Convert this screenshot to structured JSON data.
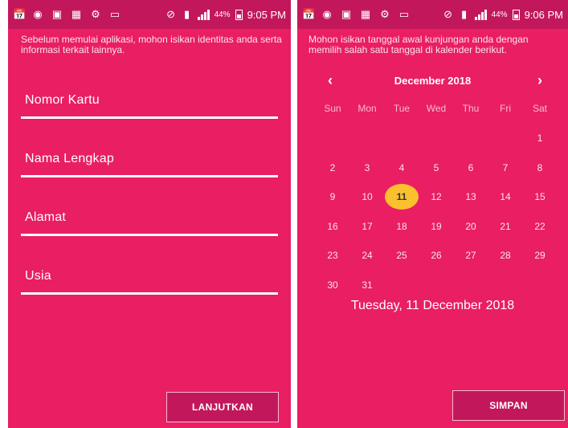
{
  "left_screen": {
    "status": {
      "time": "9:05 PM",
      "battery": "44%"
    },
    "intro": "Sebelum memulai aplikasi, mohon isikan identitas anda serta informasi terkait lainnya.",
    "fields": [
      "Nomor Kartu",
      "Nama Lengkap",
      "Alamat",
      "Usia"
    ],
    "button": "LANJUTKAN"
  },
  "right_screen": {
    "status": {
      "time": "9:06 PM",
      "battery": "44%"
    },
    "intro": "Mohon isikan tanggal awal kunjungan anda dengan memilih salah satu tanggal di kalender berikut.",
    "calendar": {
      "prev_icon": "chevron-left-icon",
      "next_icon": "chevron-right-icon",
      "month_label": "December 2018",
      "weekdays": [
        "Sun",
        "Mon",
        "Tue",
        "Wed",
        "Thu",
        "Fri",
        "Sat"
      ],
      "days": [
        "1",
        "2",
        "3",
        "4",
        "5",
        "6",
        "7",
        "8",
        "9",
        "10",
        "11",
        "12",
        "13",
        "14",
        "15",
        "16",
        "17",
        "18",
        "19",
        "20",
        "21",
        "22",
        "23",
        "24",
        "25",
        "26",
        "27",
        "28",
        "29",
        "30",
        "31"
      ],
      "first_weekday_index": 6,
      "selected_day": "11",
      "selected_date_text": "Tuesday, 11 December 2018"
    },
    "button": "SIMPAN"
  },
  "colors": {
    "background": "#e91e63",
    "statusbar": "#c2185b",
    "selected": "#fbc02d"
  },
  "status_icons": [
    "calendar-icon",
    "chat-icon",
    "image-icon",
    "photo-icon",
    "settings-icon",
    "nfc-icon"
  ]
}
